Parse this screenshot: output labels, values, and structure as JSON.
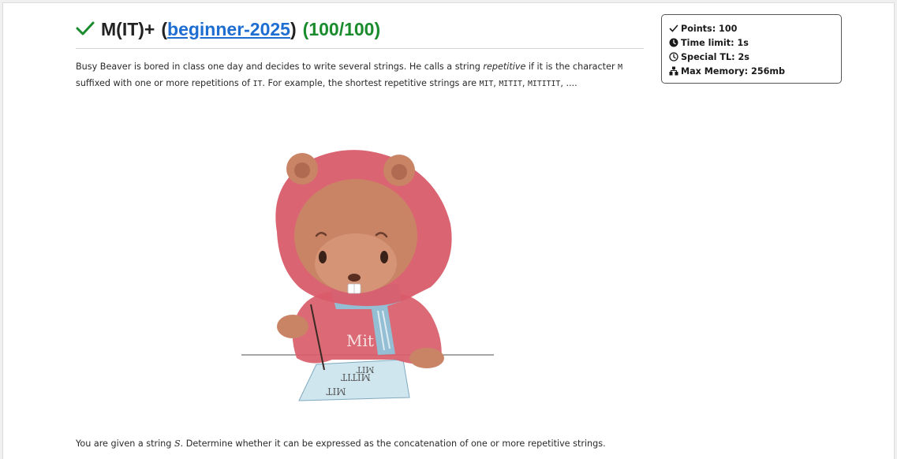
{
  "problem": {
    "status_icon": "check-icon",
    "name": "M(IT)+",
    "paren_open": "(",
    "contest_link": "beginner-2025",
    "paren_close": ")",
    "score": "(100/100)"
  },
  "statement": {
    "p1_a": "Busy Beaver is bored in class one day and decides to write several strings. He calls a string ",
    "p1_em": "repetitive",
    "p1_b": " if it is the character ",
    "p1_code_m": "M",
    "p1_c": " suffixed with one or more repetitions of ",
    "p1_code_it": "IT",
    "p1_d": ". For example, the shortest repetitive strings are ",
    "ex1": "MIT",
    "sep1": ", ",
    "ex2": "MITIT",
    "sep2": ", ",
    "ex3": "MITITIT",
    "p1_e": ", ....",
    "p2_a": "You are given a string ",
    "p2_var": "S",
    "p2_b": ". Determine whether it can be expressed as the concatenation of one or more repetitive strings."
  },
  "illustration": {
    "hoodie_text": "Mit",
    "paper_line1": "MIT",
    "paper_line2": "MITIT",
    "paper_line3": "MIT",
    "colors": {
      "hood": "#d95c6a",
      "fur": "#c98466",
      "scarf": "#8ec3d8",
      "paper": "#cfe6ef"
    }
  },
  "info": {
    "points": "Points: 100",
    "time_limit": "Time limit: 1s",
    "special_tl": "Special TL: 2s",
    "max_memory": "Max Memory: 256mb",
    "icons": [
      "check-icon",
      "clock-filled-icon",
      "clock-outline-icon",
      "memory-icon"
    ]
  }
}
